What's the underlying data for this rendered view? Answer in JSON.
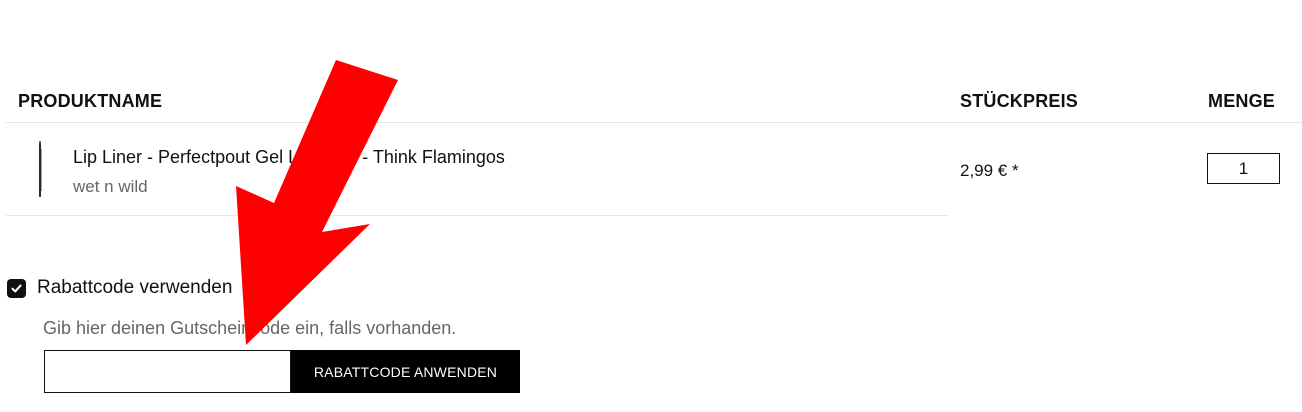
{
  "cart": {
    "headers": {
      "product_name": "PRODUKTNAME",
      "unit_price": "STÜCKPREIS",
      "quantity": "MENGE"
    },
    "items": [
      {
        "name": "Lip Liner - Perfectpout Gel Lip Liner - Think Flamingos",
        "brand": "wet n wild",
        "unit_price": "2,99 € *",
        "quantity": "1",
        "thumbnail_icon": "lip-liner-pencil-icon"
      }
    ]
  },
  "coupon": {
    "toggle_checked": true,
    "toggle_label": "Rabattcode verwenden",
    "hint": "Gib hier deinen Gutscheincode ein, falls vorhanden.",
    "input_value": "",
    "apply_button_label": "RABATTCODE ANWENDEN"
  },
  "annotation": {
    "arrow_icon": "pointer-arrow-icon",
    "color": "#ff0000"
  },
  "colors": {
    "text": "#111111",
    "muted_text": "#666666",
    "divider": "#e6e6e6",
    "button_bg": "#000000",
    "button_text": "#ffffff"
  }
}
